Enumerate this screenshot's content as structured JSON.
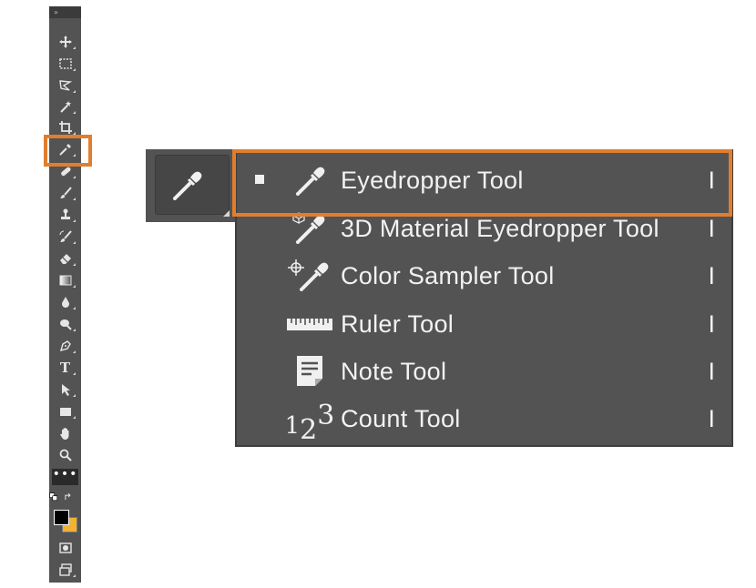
{
  "toolbar": {
    "collapse_glyph": "»",
    "more_glyph": "•••",
    "tools": [
      {
        "name": "move-tool-icon"
      },
      {
        "name": "rectangular-marquee-icon"
      },
      {
        "name": "lasso-icon"
      },
      {
        "name": "magic-wand-icon"
      },
      {
        "name": "crop-icon"
      },
      {
        "name": "eyedropper-icon"
      },
      {
        "name": "healing-brush-icon"
      },
      {
        "name": "brush-icon"
      },
      {
        "name": "clone-stamp-icon"
      },
      {
        "name": "history-brush-icon"
      },
      {
        "name": "eraser-icon"
      },
      {
        "name": "gradient-icon"
      },
      {
        "name": "blur-icon"
      },
      {
        "name": "dodge-icon"
      },
      {
        "name": "pen-icon"
      },
      {
        "name": "type-icon"
      },
      {
        "name": "path-selection-icon"
      },
      {
        "name": "rectangle-shape-icon"
      },
      {
        "name": "hand-icon"
      },
      {
        "name": "zoom-icon"
      }
    ],
    "type_glyph": "T",
    "foreground_color": "#000000",
    "background_color": "#f2b233"
  },
  "flyout": {
    "items": [
      {
        "label": "Eyedropper Tool",
        "shortcut": "I",
        "selected": true,
        "icon": "eyedropper-icon"
      },
      {
        "label": "3D Material Eyedropper Tool",
        "shortcut": "I",
        "selected": false,
        "icon": "3d-material-eyedropper-icon"
      },
      {
        "label": "Color Sampler Tool",
        "shortcut": "I",
        "selected": false,
        "icon": "color-sampler-icon"
      },
      {
        "label": "Ruler Tool",
        "shortcut": "I",
        "selected": false,
        "icon": "ruler-icon"
      },
      {
        "label": "Note Tool",
        "shortcut": "I",
        "selected": false,
        "icon": "note-icon"
      },
      {
        "label": "Count Tool",
        "shortcut": "I",
        "selected": false,
        "icon": "count-icon"
      }
    ],
    "count_glyph": {
      "a": "1",
      "b": "2",
      "c": "3"
    }
  },
  "colors": {
    "panel": "#535353",
    "highlight": "#e07e2e",
    "text": "#f2f2f2"
  }
}
